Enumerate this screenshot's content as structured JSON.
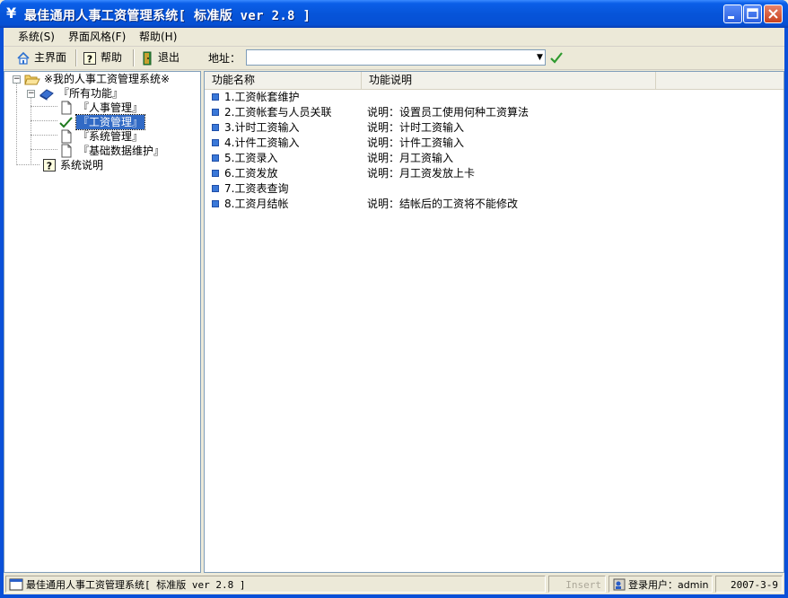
{
  "window": {
    "title": "最佳通用人事工资管理系统[ 标准版 ver 2.8 ]",
    "title_icon": "¥"
  },
  "menu": [
    {
      "label": "系统(S)"
    },
    {
      "label": "界面风格(F)"
    },
    {
      "label": "帮助(H)"
    }
  ],
  "toolbar": {
    "home_label": "主界面",
    "help_label": "帮助",
    "exit_label": "退出",
    "address_label": "地址：",
    "address_value": ""
  },
  "tree": {
    "root": "※我的人事工资管理系统※",
    "all_functions": "『所有功能』",
    "hr": "『人事管理』",
    "payroll": "『工资管理』",
    "system": "『系统管理』",
    "basic_data": "『基础数据维护』",
    "system_help": "系统说明"
  },
  "list": {
    "columns": [
      "功能名称",
      "功能说明"
    ],
    "rows": [
      {
        "name": "1.工资帐套维护",
        "desc": ""
      },
      {
        "name": "2.工资帐套与人员关联",
        "desc": "说明：设置员工使用何种工资算法"
      },
      {
        "name": "3.计时工资输入",
        "desc": "说明：计时工资输入"
      },
      {
        "name": "4.计件工资输入",
        "desc": "说明：计件工资输入"
      },
      {
        "name": "5.工资录入",
        "desc": "说明：月工资输入"
      },
      {
        "name": "6.工资发放",
        "desc": "说明：月工资发放上卡"
      },
      {
        "name": "7.工资表查询",
        "desc": ""
      },
      {
        "name": "8.工资月结帐",
        "desc": "说明：结帐后的工资将不能修改"
      }
    ]
  },
  "status": {
    "app_title": "最佳通用人事工资管理系统[ 标准版 ver 2.8 ]",
    "insert": "Insert",
    "user": "登录用户：admin",
    "date": "2007-3-9"
  },
  "colors": {
    "titlebar": "#0654d9",
    "selection": "#316ac5",
    "bullet": "#3a78d8",
    "close_button": "#c8421e"
  }
}
